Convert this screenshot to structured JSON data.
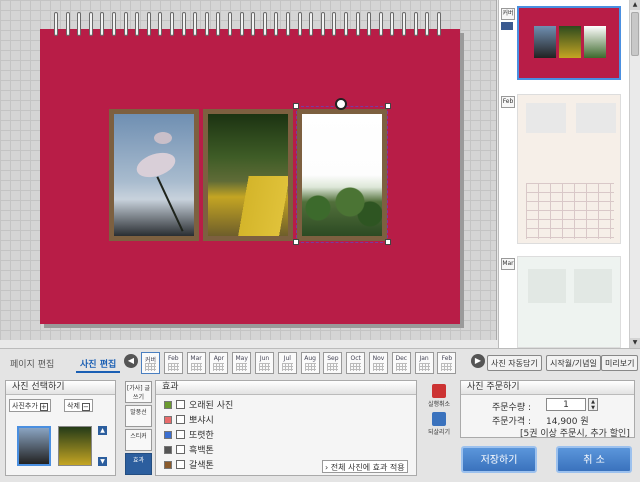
{
  "thumbnails": [
    {
      "label": "커버"
    },
    {
      "label": "Feb"
    },
    {
      "label": "Mar"
    }
  ],
  "bottom_tabs": {
    "page_edit": "페이지 편집",
    "photo_edit": "사진 편집"
  },
  "months": [
    "커버",
    "Feb",
    "Mar",
    "Apr",
    "May",
    "Jun",
    "Jul",
    "Aug",
    "Sep",
    "Oct",
    "Nov",
    "Dec",
    "Jan",
    "Feb"
  ],
  "right_buttons": {
    "auto_fill": "사진 자동담기",
    "start_date": "시작월/기념일",
    "preview": "미리보기"
  },
  "photo_select": {
    "title": "사진 선택하기",
    "add": "사진추가",
    "add_icon": "+",
    "delete": "삭제",
    "delete_icon": "−"
  },
  "tools": {
    "text": "[가사] 글쓰기",
    "balloon": "말풍선",
    "sticker": "스티커",
    "effect": "효과"
  },
  "effects": {
    "title": "효과",
    "old_photo": "오래된 사진",
    "items": [
      {
        "label": "뽀샤시",
        "swatch": "#e86a6a"
      },
      {
        "label": "또렷한",
        "swatch": "#3b6fd1"
      },
      {
        "label": "흑백톤",
        "swatch": "#555555"
      },
      {
        "label": "갈색톤",
        "swatch": "#8a5a2b"
      }
    ],
    "old_photo_swatch": "#6a9a2f",
    "apply_all": "전체 사진에 효과 적용"
  },
  "undo": {
    "undo": "실행취소",
    "redo": "되살리기"
  },
  "order": {
    "title": "사진 주문하기",
    "qty_label": "주문수량 :",
    "qty_value": "1",
    "price_label": "주문가격 :",
    "price_value": "14,900 원",
    "discount": "[5권 이상 주문시, 추가 할인]"
  },
  "actions": {
    "save": "저장하기",
    "cancel": "취 소"
  },
  "colors": {
    "page": "#b81d47",
    "accent": "#1a5fb4"
  }
}
